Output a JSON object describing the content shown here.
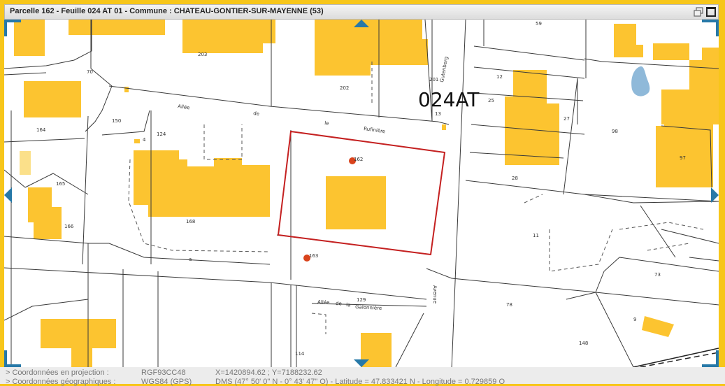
{
  "window": {
    "title": "Parcelle 162 - Feuille 024 AT 01 - Commune : CHATEAU-GONTIER-SUR-MAYENNE (53)"
  },
  "map": {
    "sheet_label": "024AT",
    "colors": {
      "building": "#fcc430",
      "building_light": "#fbe08a",
      "water": "#8fb9d9",
      "parcel_line": "#3a3a3a",
      "selected_outline": "#c42020",
      "nav_accent": "#2779a8"
    },
    "parcel_numbers": {
      "p59": "59",
      "p203": "203",
      "p70": "70",
      "p202": "202",
      "p201": "201",
      "p12": "12",
      "p25": "25",
      "p13": "13",
      "p27": "27",
      "p98": "98",
      "p97": "97",
      "p164": "164",
      "p150": "150",
      "p124": "124",
      "p4": "4",
      "p162": "162",
      "p165": "165",
      "p168": "168",
      "p28": "28",
      "p166": "166",
      "p11": "11",
      "p163": "163",
      "pa": "a",
      "p73": "73",
      "p129": "129",
      "p78": "78",
      "p9": "9",
      "p148": "148",
      "p114": "114"
    },
    "street_labels": {
      "allee": "Allée",
      "de": "de",
      "le": "le",
      "rufiniere": "Rufinière",
      "gutenberg": "Gutenberg",
      "avenue": "Avenue",
      "allee2": "Allée",
      "de2": "de",
      "la": "la",
      "galonniere": "Galonnière"
    }
  },
  "status": {
    "projection": {
      "label": "> Coordonnées en projection :",
      "system": "RGF93CC48",
      "value": "X=1420894.62 ; Y=7188232.62"
    },
    "geographic": {
      "label": "> Coordonnées géographiques :",
      "system": "WGS84 (GPS)",
      "value": "DMS (47° 50' 0\" N - 0° 43' 47\" O) - Latitude = 47.833421 N - Longitude = 0.729859 O"
    }
  }
}
